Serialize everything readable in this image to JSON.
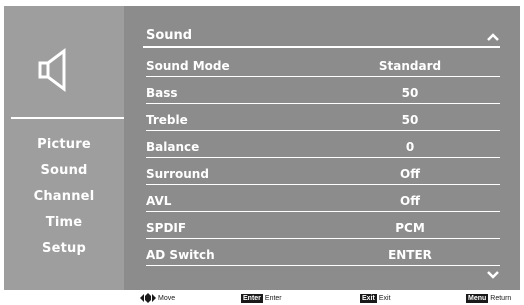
{
  "osd": {
    "left_icon": "speaker-icon",
    "menu": {
      "items": [
        {
          "label": "Picture"
        },
        {
          "label": "Sound"
        },
        {
          "label": "Channel"
        },
        {
          "label": "Time"
        },
        {
          "label": "Setup"
        }
      ]
    },
    "section": {
      "title": "Sound",
      "scroll_up_icon": "chevron-up-icon",
      "scroll_down_icon": "chevron-down-icon"
    },
    "settings": [
      {
        "label": "Sound Mode",
        "value": "Standard"
      },
      {
        "label": "Bass",
        "value": "50"
      },
      {
        "label": "Treble",
        "value": "50"
      },
      {
        "label": "Balance",
        "value": "0"
      },
      {
        "label": "Surround",
        "value": "Off"
      },
      {
        "label": "AVL",
        "value": "Off"
      },
      {
        "label": "SPDIF",
        "value": "PCM"
      },
      {
        "label": "AD Switch",
        "value": "ENTER"
      }
    ]
  },
  "hints": {
    "move": {
      "icon": "dpad-icon",
      "text": "Move"
    },
    "enter": {
      "key": "Enter",
      "text": "Enter"
    },
    "exit": {
      "key": "Exit",
      "text": "Exit"
    },
    "menu": {
      "key": "Menu",
      "text": "Return"
    }
  },
  "colors": {
    "left_panel": "#9e9e9e",
    "right_panel": "#8c8c8c",
    "text": "#ffffff",
    "key_badge": "#1a1a1a"
  }
}
